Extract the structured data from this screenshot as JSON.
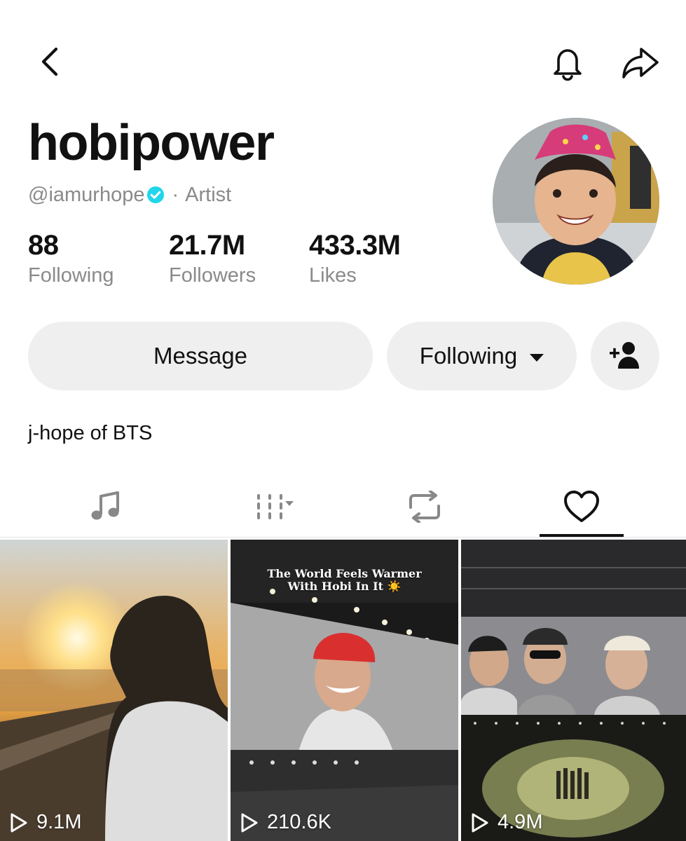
{
  "profile": {
    "display_name": "hobipower",
    "handle": "@iamurhope",
    "separator": "·",
    "category": "Artist",
    "bio": "j-hope of BTS"
  },
  "stats": [
    {
      "value": "88",
      "label": "Following"
    },
    {
      "value": "21.7M",
      "label": "Followers"
    },
    {
      "value": "433.3M",
      "label": "Likes"
    }
  ],
  "actions": {
    "message_label": "Message",
    "following_label": "Following"
  },
  "icons": {
    "back": "chevron-left-icon",
    "notifications": "bell-icon",
    "share": "share-arrow-icon",
    "verified": "verified-badge-icon",
    "add_friend": "add-user-icon",
    "tab_music": "music-note-icon",
    "tab_playlists": "playlist-icon",
    "tab_reposts": "repost-icon",
    "tab_liked": "heart-icon",
    "views": "play-icon"
  },
  "tabs": {
    "active": "liked"
  },
  "videos": [
    {
      "views": "9.1M"
    },
    {
      "views": "210.6K",
      "caption_line1": "The World Feels Warmer",
      "caption_line2": "With Hobi In It ☀️"
    },
    {
      "views": "4.9M"
    }
  ],
  "colors": {
    "verified": "#20d5ec",
    "pill_background": "#efefef",
    "secondary_text": "#8a8a8a"
  }
}
